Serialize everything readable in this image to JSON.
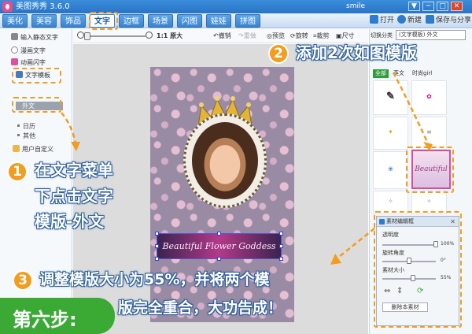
{
  "window": {
    "title": "美图秀秀 3.6.0",
    "user": "smile",
    "controls": [
      "▼",
      "─",
      "□",
      "✕"
    ]
  },
  "tabs": [
    {
      "label": "美化",
      "active": false
    },
    {
      "label": "美容",
      "active": false
    },
    {
      "label": "饰品",
      "active": false
    },
    {
      "label": "文字",
      "active": true
    },
    {
      "label": "边框",
      "active": false
    },
    {
      "label": "场景",
      "active": false
    },
    {
      "label": "闪图",
      "active": false
    },
    {
      "label": "娃娃",
      "active": false
    },
    {
      "label": "拼图",
      "active": false
    }
  ],
  "tabbar_right": {
    "open": "打开",
    "new": "新建",
    "save_share": "保存与分享"
  },
  "left_panel": {
    "items": {
      "static_text": "输入静态文字",
      "comic_text": "漫画文字",
      "animated_text": "动画闪字",
      "text_template": "文字模板",
      "user_custom": "用户自定义"
    },
    "sub_items": [
      "外文",
      "日历",
      "其他"
    ],
    "selected_sub": "外文"
  },
  "toolbar": {
    "zoom_label": "1:1 原大",
    "undo": "撤销",
    "redo": "重做",
    "preview": "预览",
    "rotate": "旋转",
    "crop": "裁剪",
    "size": "尺寸"
  },
  "canvas": {
    "text_overlay": "Beautiful Flower Goddess"
  },
  "right_panel": {
    "category_label": "切换分类",
    "category_value": "(文字模板) 外文",
    "tabs": [
      "全部",
      "英文",
      "时尚girl"
    ],
    "active_tab": "全部",
    "thumbnails": [
      {
        "text": "Beautiful",
        "selected": true
      }
    ]
  },
  "editor": {
    "title": "素材编辑框",
    "opacity_label": "透明度",
    "opacity_value": "100%",
    "rotation_label": "旋转角度",
    "rotation_value": "0°",
    "size_label": "素材大小",
    "size_value": "55%",
    "delete_button": "删除本素材"
  },
  "annotations": {
    "step1_num": "1",
    "step1_lines": [
      "在文字菜单",
      "下点击文字",
      "模版-外文"
    ],
    "step2_num": "2",
    "step2_text": "添加2次如图模版",
    "step3_num": "3",
    "step3_line1": "调整模版大小为55%，并将两个模",
    "step3_line2": "版完全重合，大功告成！",
    "step_label": "第六步:"
  },
  "colors": {
    "accent": "#f39c1e",
    "titlebar": "#2a74c5",
    "step_green": "#3aaa35",
    "text_outline": "#2d5f9a"
  }
}
